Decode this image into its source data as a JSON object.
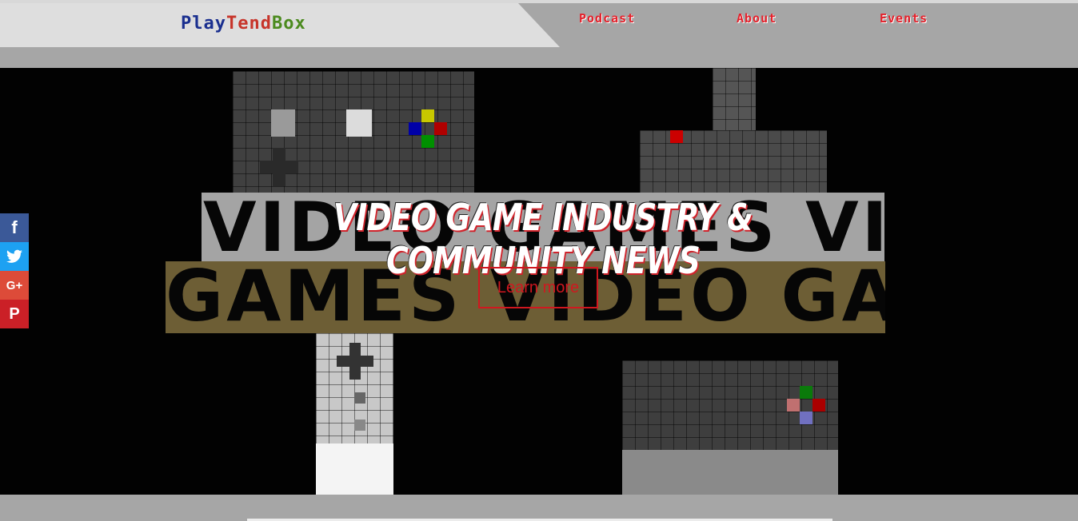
{
  "brand": {
    "part1": "Play",
    "part2": "Tend",
    "part3": "Box"
  },
  "nav": [
    {
      "label": "Podcast"
    },
    {
      "label": "About"
    },
    {
      "label": "Events"
    }
  ],
  "hero": {
    "headline": "VIDEO GAME INDUSTRY & COMMUNITY NEWS",
    "band1_text": "VIDEO GAMES VIDEO",
    "band2_text": "GAMES VIDEO GAMES",
    "cta_label": "Learn more"
  },
  "social": [
    {
      "icon": "facebook-icon",
      "glyph": "f",
      "color": "#3b5998"
    },
    {
      "icon": "twitter-icon",
      "glyph": "🐦",
      "color": "#1da1f2"
    },
    {
      "icon": "google-plus-icon",
      "glyph": "G+",
      "color": "#dd4b39"
    },
    {
      "icon": "pinterest-icon",
      "glyph": "P",
      "color": "#cb2027"
    }
  ],
  "colors": {
    "accent": "#e4202a",
    "header_bg": "#dedede",
    "hero_bg": "#020202"
  }
}
